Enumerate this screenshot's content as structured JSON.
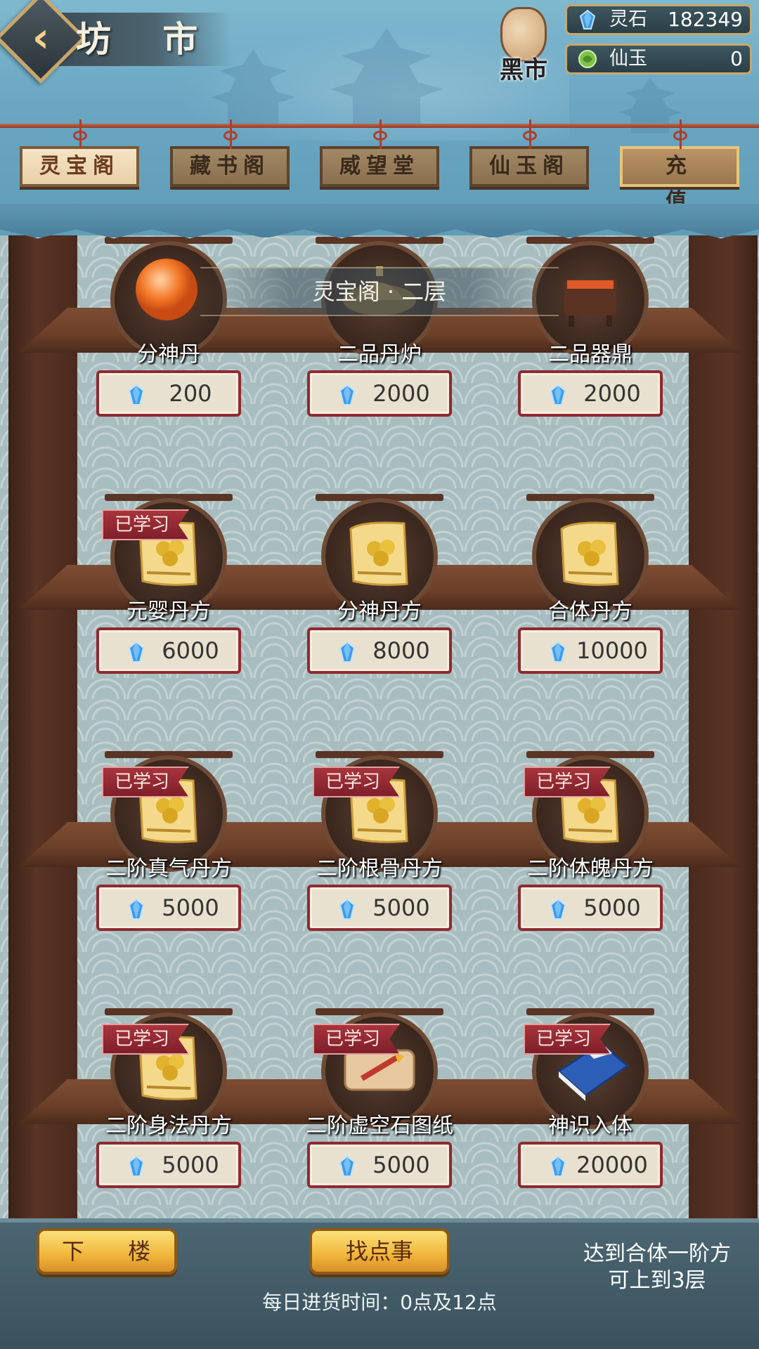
{
  "header": {
    "title": "坊 市",
    "black_market_label": "黑市",
    "currencies": [
      {
        "name": "灵石",
        "value": "182349",
        "icon": "blue-crystal-icon"
      },
      {
        "name": "仙玉",
        "value": "0",
        "icon": "green-jade-icon"
      }
    ]
  },
  "tabs": [
    {
      "label": "灵宝阁",
      "active": true
    },
    {
      "label": "藏书阁",
      "active": false
    },
    {
      "label": "威望堂",
      "active": false
    },
    {
      "label": "仙玉阁",
      "active": false
    },
    {
      "label": "充 值",
      "active": false
    }
  ],
  "floor_banner": "灵宝阁 · 二层",
  "items": [
    {
      "name": "分神丹",
      "price": "200",
      "learned": false,
      "icon": "orange-pill-icon"
    },
    {
      "name": "二品丹炉",
      "price": "2000",
      "learned": false,
      "icon": "furnace-icon"
    },
    {
      "name": "二品器鼎",
      "price": "2000",
      "learned": false,
      "icon": "cauldron-icon"
    },
    {
      "name": "元婴丹方",
      "price": "6000",
      "learned": true,
      "icon": "scroll-icon"
    },
    {
      "name": "分神丹方",
      "price": "8000",
      "learned": false,
      "icon": "scroll-icon"
    },
    {
      "name": "合体丹方",
      "price": "10000",
      "learned": false,
      "icon": "scroll-icon"
    },
    {
      "name": "二阶真气丹方",
      "price": "5000",
      "learned": true,
      "icon": "scroll-icon"
    },
    {
      "name": "二阶根骨丹方",
      "price": "5000",
      "learned": true,
      "icon": "scroll-icon"
    },
    {
      "name": "二阶体魄丹方",
      "price": "5000",
      "learned": true,
      "icon": "scroll-icon"
    },
    {
      "name": "二阶身法丹方",
      "price": "5000",
      "learned": true,
      "icon": "scroll-icon"
    },
    {
      "name": "二阶虚空石图纸",
      "price": "5000",
      "learned": true,
      "icon": "blueprint-scroll-icon"
    },
    {
      "name": "神识入体",
      "price": "20000",
      "learned": true,
      "icon": "blue-book-icon"
    }
  ],
  "learned_label": "已学习",
  "footer": {
    "down_button": "下 楼",
    "find_button": "找点事",
    "refresh_text": "每日进货时间：0点及12点",
    "next_floor_hint": "达到合体一阶方可上到3层"
  },
  "colors": {
    "header_bg": "#6aa6c2",
    "price_border": "#8f2a30",
    "gold_button": "#f0b53a",
    "learned_badge": "#a8343c",
    "crystal": "#2f8fe0"
  }
}
